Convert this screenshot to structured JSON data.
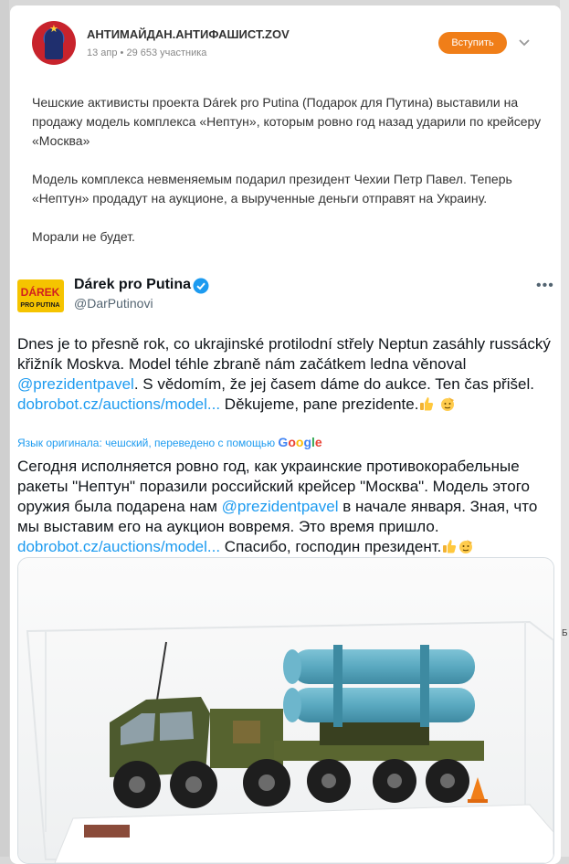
{
  "right_edge_label": "Б",
  "header": {
    "group_name": "АНТИМАЙДАН.АНТИФАШИСТ.ZOV",
    "meta": "13 апр • 29 653 участника",
    "join_label": "Вступить"
  },
  "post": {
    "paragraphs": [
      "Чешские активисты проекта Dárek pro Putina (Подарок для Путина) выставили на продажу  модель комплекса «Нептун», которым ровно год назад ударили по крейсеру «Москва»",
      "Модель комплекса невменяемым подарил президент Чехии Петр Павел. Теперь «Нептун» продадут на аукционе, а вырученные деньги отправят на Украину.",
      "Морали не будет."
    ]
  },
  "tweet": {
    "logo_text_top": "DÁREK",
    "logo_text_bottom": "PRO PUTINA",
    "name": "Dárek pro Putina",
    "handle": "@DarPutinovi",
    "more": "•••",
    "original": {
      "part1": "Dnes je to přesně rok, co ukrajinské protilodní střely Neptun zasáhly russácký křižník Moskva. Model téhle zbraně nám začátkem ledna věnoval ",
      "mention": "@prezidentpavel",
      "part2": ". S vědomím, že jej časem dáme do aukce. Ten čas přišel. ",
      "link": "dobrobot.cz/auctions/model...",
      "part3": " Děkujeme, pane prezidente."
    },
    "translation_note": "Язык оригинала: чешский, переведено с помощью",
    "google_label": "Google",
    "translated": {
      "part1": "Сегодня исполняется ровно год, как украинские противокорабельные ракеты \"Нептун\" поразили российский крейсер \"Москва\". Модель этого оружия была подарена нам ",
      "mention": "@prezidentpavel",
      "part2": " в начале января. Зная, что мы выставим его на аукцион вовремя. Это время пришло.",
      "link": "dobrobot.cz/auctions/model...",
      "part3": " Спасибо, господин президент."
    }
  },
  "icons": [
    "chevron-down-icon",
    "verified-badge-icon",
    "thumbs-up-emoji",
    "salute-emoji"
  ],
  "colors": {
    "join_button": "#f07e18",
    "link": "#1d9bf0",
    "verified": "#1d9bf0"
  }
}
